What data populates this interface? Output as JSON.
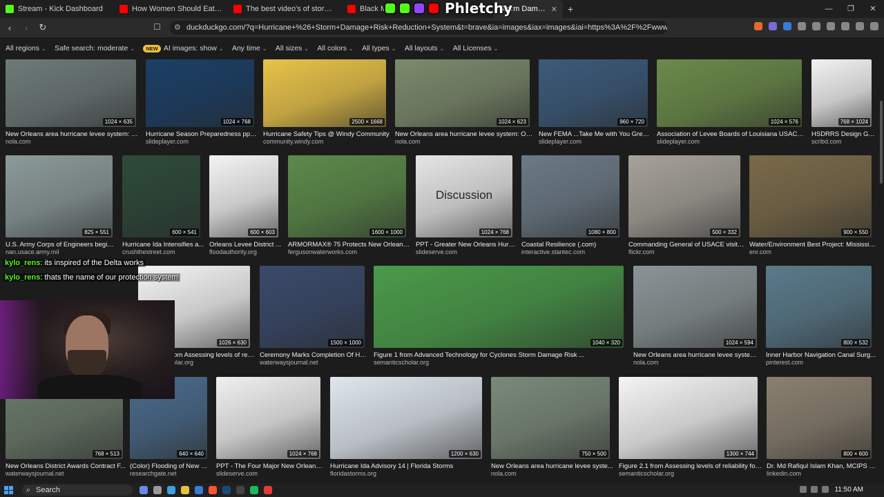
{
  "tabs": [
    {
      "title": "Stream - Kick Dashboard",
      "color": "#53fc18",
      "active": false
    },
    {
      "title": "How Women Should Eat, Supplemen",
      "color": "#ff0000",
      "active": false
    },
    {
      "title": "The best video's of storm Eunice (150",
      "color": "#ff0000",
      "active": false
    },
    {
      "title": "Black Myth",
      "color": "#ff0000",
      "active": false
    },
    {
      "title": "Storm Damage Risk",
      "color": "#de5833",
      "active": true
    }
  ],
  "overlay_logo": "Phletchy",
  "url": "duckduckgo.com/?q=Hurricane+%26+Storm+Damage+Risk+Reduction+System&t=brave&ia=images&iax=images&iai=https%3A%2F%2Fwww.floo...",
  "filters": {
    "regions": "All regions",
    "safe": "Safe search: moderate",
    "new_badge": "NEW",
    "ai_images": "AI images: show",
    "time": "Any time",
    "sizes": "All sizes",
    "colors": "All colors",
    "types": "All types",
    "layouts": "All layouts",
    "licenses": "All Licenses"
  },
  "results": [
    {
      "title": "New Orleans area hurricane levee system: Ov...",
      "source": "nola.com",
      "dims": "1024 × 635",
      "color": "#6d7a78"
    },
    {
      "title": "Hurricane Season Preparedness ppt ...",
      "source": "slideplayer.com",
      "dims": "1024 × 768",
      "color": "#1c3f66"
    },
    {
      "title": "Hurricane Safety Tips @ Windy Community",
      "source": "community.windy.com",
      "dims": "2500 × 1668",
      "color": "#e8c34a"
    },
    {
      "title": "New Orleans area hurricane levee system: Ove...",
      "source": "nola.com",
      "dims": "1024 × 623",
      "color": "#7c8a6c"
    },
    {
      "title": "New FEMA ...Take Me with You Great...",
      "source": "slideplayer.com",
      "dims": "960 × 720",
      "color": "#3c5a7a"
    },
    {
      "title": "Association of Levee Boards of Louisiana USACE N...",
      "source": "slideplayer.com",
      "dims": "1024 × 576",
      "color": "#6b8a4a"
    },
    {
      "title": "HSDRRS Design Gui...",
      "source": "scribd.com",
      "dims": "768 × 1024",
      "color": "#f2f2f2"
    },
    {
      "title": "U.S. Army Corps of Engineers begins ...",
      "source": "nan.usace.army.mil",
      "dims": "825 × 551",
      "color": "#8c9a9a"
    },
    {
      "title": "Hurricane Ida Intensifies a...",
      "source": "crushthestreet.com",
      "dims": "600 × 541",
      "color": "#2e4a3a"
    },
    {
      "title": "Orleans Levee District ...",
      "source": "floodauthority.org",
      "dims": "600 × 603",
      "color": "#f4f4f4"
    },
    {
      "title": "ARMORMAX® 75 Protects New Orleans L...",
      "source": "fergusonwaterworks.com",
      "dims": "1600 × 1000",
      "color": "#5c8a4a"
    },
    {
      "title": "PPT - Greater New Orleans Hurri...",
      "source": "slideserve.com",
      "dims": "1024 × 768",
      "color": "#e6e6e6",
      "text": "Discussion"
    },
    {
      "title": "Coastal Resilience (.com)",
      "source": "interactive.stantec.com",
      "dims": "1080 × 800",
      "color": "#6c7a86"
    },
    {
      "title": "Commanding General of USACE visits ...",
      "source": "flickr.com",
      "dims": "500 × 332",
      "color": "#a6a29a"
    },
    {
      "title": "Water/Environment Best Project: Mississip...",
      "source": "enr.com",
      "dims": "900 × 550",
      "color": "#7a6a4a"
    },
    {
      "title": "Figure 1.2 from Assessing levels of reliab...",
      "source": "semanticscholar.org",
      "dims": "1026 × 630",
      "color": "#f4f4f4"
    },
    {
      "title": "Ceremony Marks Completion Of Hur...",
      "source": "waterwaysjournal.net",
      "dims": "1500 × 1000",
      "color": "#3a4a6a"
    },
    {
      "title": "Figure 1 from Advanced Technology for Cyclones Storm Damage Risk ...",
      "source": "semanticscholar.org",
      "dims": "1040 × 320",
      "color": "#4a9a4a"
    },
    {
      "title": "New Orleans area hurricane levee system: ...",
      "source": "nola.com",
      "dims": "1024 × 594",
      "color": "#8a9496"
    },
    {
      "title": "Inner Harbor Navigation Canal Surg...",
      "source": "pinterest.com",
      "dims": "800 × 532",
      "color": "#5a7a8a"
    },
    {
      "title": "New Orleans District Awards Contract F...",
      "source": "waterwaysjournal.net",
      "dims": "768 × 513",
      "color": "#6a7a6a"
    },
    {
      "title": "(Color) Flooding of New O...",
      "source": "researchgate.net",
      "dims": "640 × 640",
      "color": "#4a6a8a"
    },
    {
      "title": "PPT - The Four Major New Orleans ...",
      "source": "slideserve.com",
      "dims": "1024 × 768",
      "color": "#f0f0f0"
    },
    {
      "title": "Hurricane Ida Advisory 14 | Florida Storms",
      "source": "floridastorms.org",
      "dims": "1200 × 630",
      "color": "#dfe6ee"
    },
    {
      "title": "New Orleans area hurricane levee syste...",
      "source": "nola.com",
      "dims": "750 × 500",
      "color": "#7a8a7a"
    },
    {
      "title": "Figure 2.1 from Assessing levels of reliability for ...",
      "source": "semanticscholar.org",
      "dims": "1300 × 744",
      "color": "#f4f4f4"
    },
    {
      "title": "Dr. Md Rafiqul Islam Khan, MCIPS o...",
      "source": "linkedin.com",
      "dims": "800 × 600",
      "color": "#8a8070"
    }
  ],
  "chat": [
    {
      "user": "kylo_rens",
      "message": ": its inspired of the Delta works"
    },
    {
      "user": "kylo_rens",
      "message": ": thats the name of our protection system"
    }
  ],
  "taskbar": {
    "search": "Search",
    "time": "11:50 AM"
  }
}
